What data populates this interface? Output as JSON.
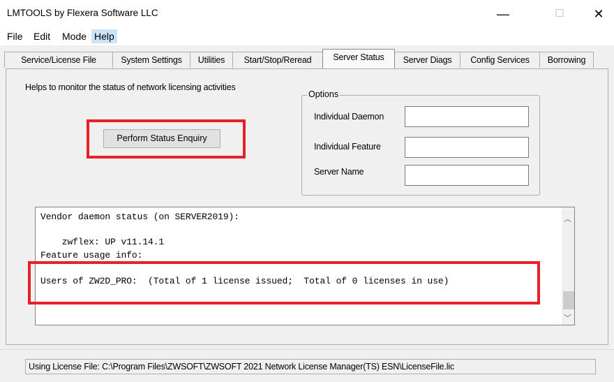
{
  "window": {
    "title": "LMTOOLS by Flexera Software LLC",
    "minimize": "—",
    "maximize": "☐",
    "close": "✕"
  },
  "menu": [
    {
      "label": "File"
    },
    {
      "label": "Edit"
    },
    {
      "label": "Mode"
    },
    {
      "label": "Help",
      "active": true
    }
  ],
  "tabs": [
    {
      "label": "Service/License File"
    },
    {
      "label": "System Settings"
    },
    {
      "label": "Utilities"
    },
    {
      "label": "Start/Stop/Reread"
    },
    {
      "label": "Server Status",
      "selected": true
    },
    {
      "label": "Server Diags"
    },
    {
      "label": "Config Services"
    },
    {
      "label": "Borrowing"
    }
  ],
  "panel": {
    "help_text": "Helps to monitor the status of network licensing activities",
    "status_button": "Perform Status Enquiry",
    "options": {
      "legend": "Options",
      "individual_daemon_label": "Individual Daemon",
      "individual_daemon_value": "",
      "individual_feature_label": "Individual Feature",
      "individual_feature_value": "",
      "server_name_label": "Server Name",
      "server_name_value": ""
    }
  },
  "output": {
    "lines": [
      "Vendor daemon status (on SERVER2019):",
      "    zwflex: UP v11.14.1",
      "Feature usage info:",
      "Users of ZW2D_PRO:  (Total of 1 license issued;  Total of 0 licenses in use)"
    ]
  },
  "status_bar": {
    "text": "Using License File:  C:\\Program Files\\ZWSOFT\\ZWSOFT 2021 Network License Manager(TS) ESN\\LicenseFile.lic"
  },
  "colors": {
    "highlight": "#e8202a",
    "menu_active": "#cce4f7"
  }
}
